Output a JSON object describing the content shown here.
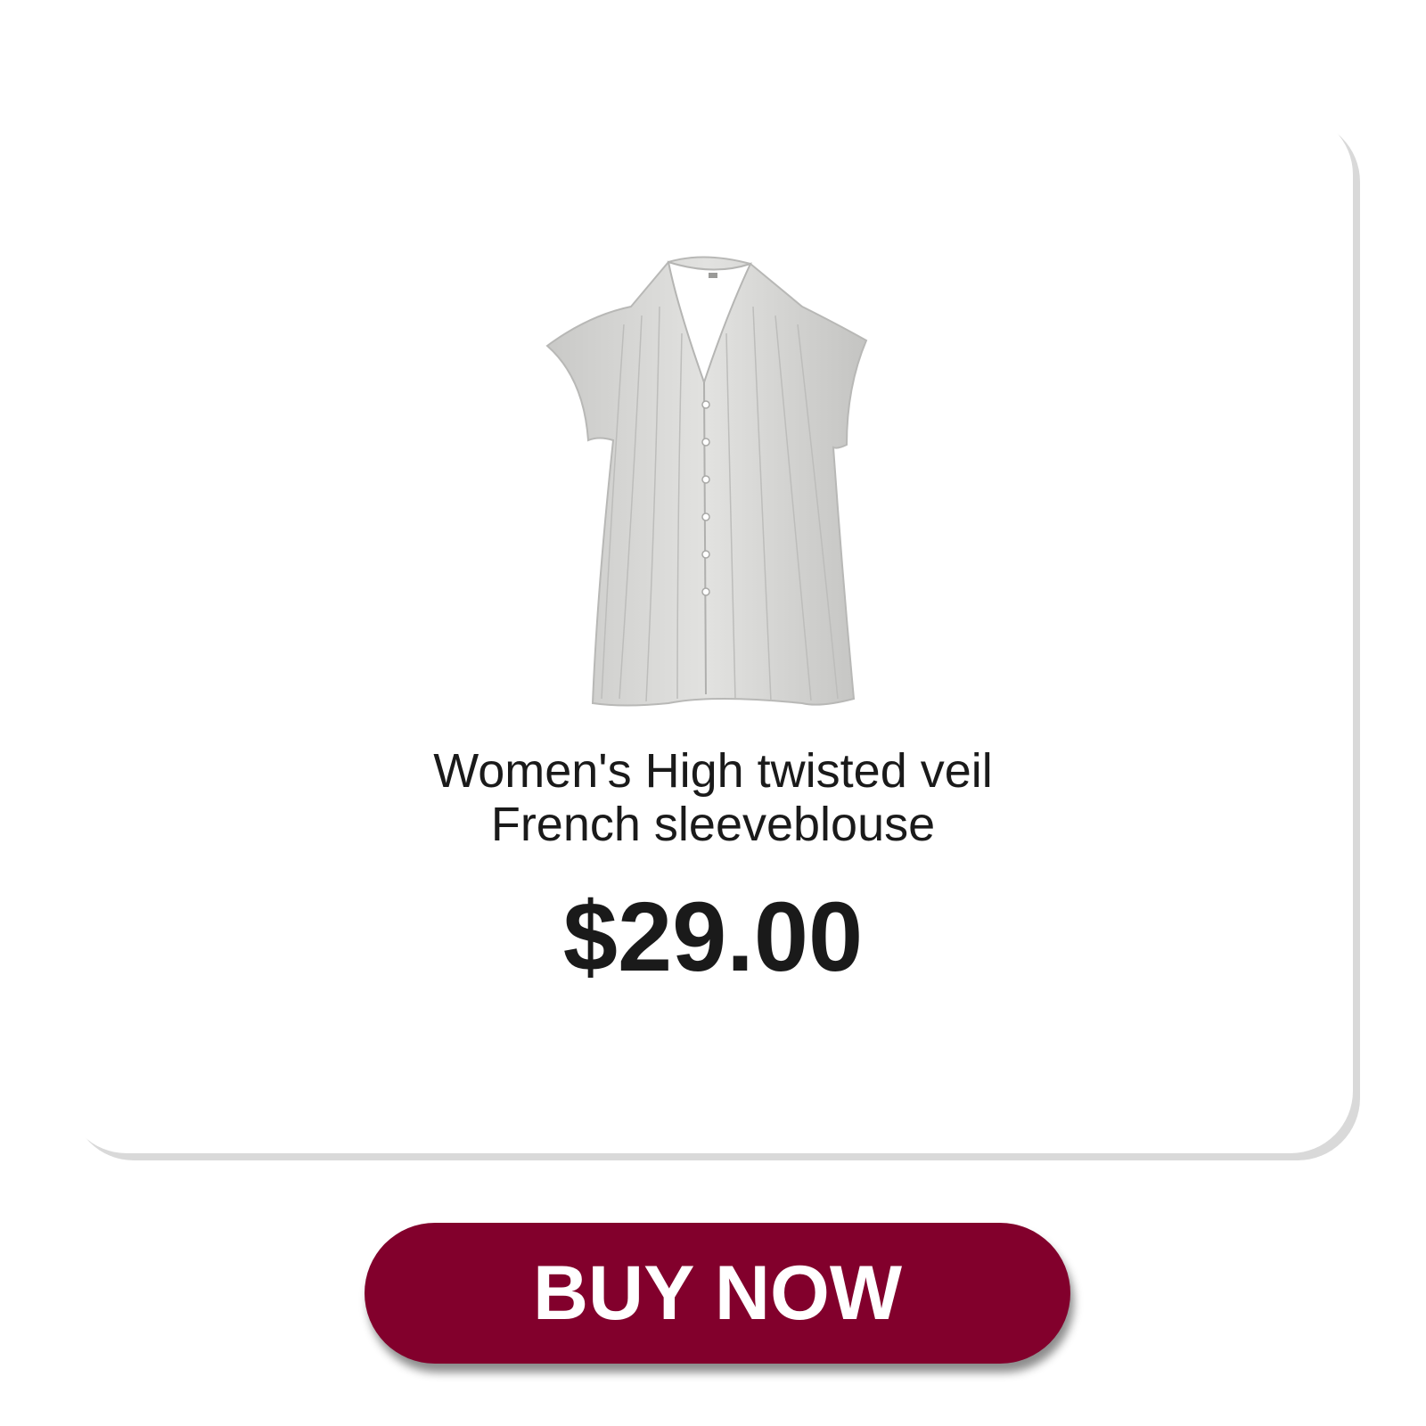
{
  "product": {
    "title_line1": "Women's High twisted veil",
    "title_line2": "French sleeveblouse",
    "price": "$29.00",
    "image_icon": "blouse-image",
    "colors": {
      "blouse": "#d6d6d4",
      "text": "#1a1a1a"
    }
  },
  "cta": {
    "label": "BUY NOW",
    "color": "#82002c",
    "text_color": "#ffffff"
  }
}
